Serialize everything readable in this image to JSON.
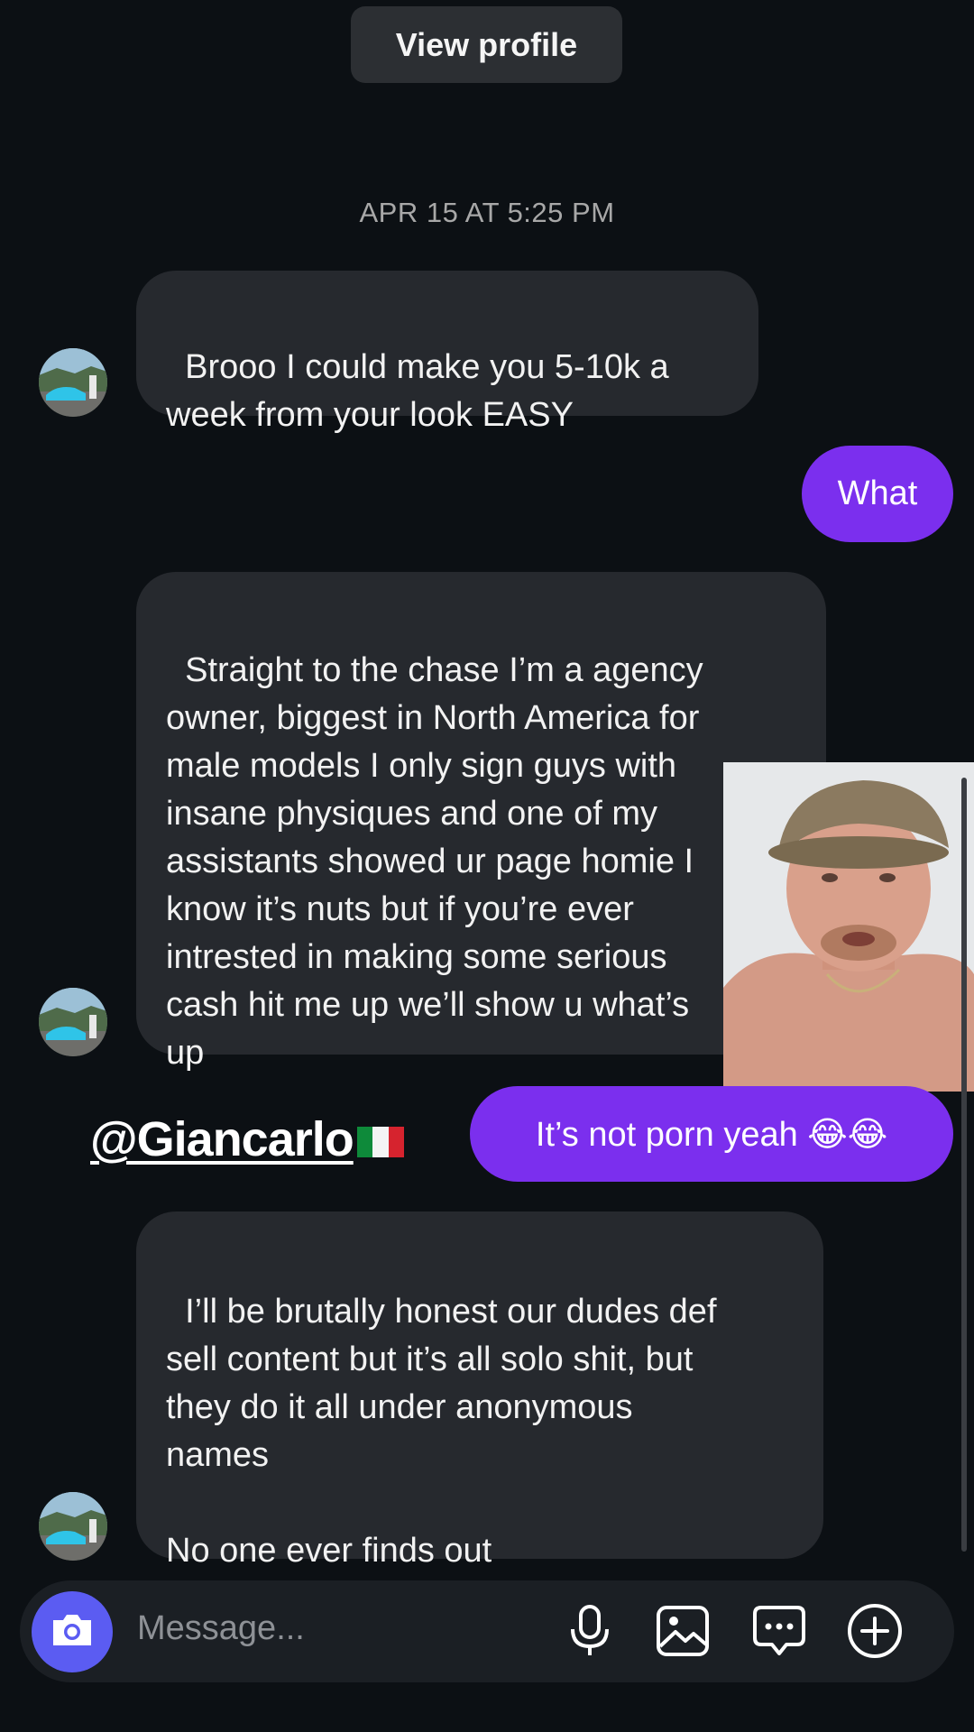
{
  "header": {
    "view_profile_label": "View profile"
  },
  "timestamp": "APR 15 AT 5:25 PM",
  "messages": [
    {
      "from": "them",
      "text": "Brooo I could make you 5-10k a\nweek from your look EASY"
    },
    {
      "from": "me",
      "text": "What"
    },
    {
      "from": "them",
      "text": "Straight to the chase I’m a agency\nowner, biggest in North America for\nmale models I only sign guys with\ninsane physiques and one of my\nassistants showed ur page homie I\nknow it’s nuts but if you’re ever\nintrested in making some serious\ncash hit me up we’ll show u what’s\nup"
    },
    {
      "from": "me",
      "text": "It’s not porn yeah 😂😂"
    },
    {
      "from": "them",
      "text": "I’ll be brutally honest our dudes def\nsell content but it’s all solo shit, but\nthey do it all under anonymous\nnames\n\nNo one ever finds out"
    }
  ],
  "overlay": {
    "mention": "@Giancarlo"
  },
  "composer": {
    "placeholder": "Message..."
  },
  "icons": [
    "camera-icon",
    "microphone-icon",
    "gallery-icon",
    "sticker-chat-icon",
    "plus-icon"
  ],
  "colors": {
    "background": "#0c1014",
    "incoming_bubble": "#26292e",
    "outgoing_bubble": "#7b2fee",
    "camera_button": "#5b5cf2"
  }
}
